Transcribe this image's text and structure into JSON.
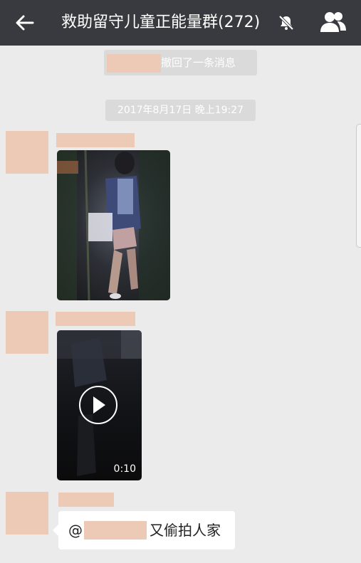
{
  "header": {
    "title": "救助留守儿童正能量群(272)",
    "back_icon": "arrow-left-icon",
    "mute_icon": "bell-off-icon",
    "members_icon": "group-members-icon",
    "background": "#393a3f"
  },
  "chat": {
    "recall_notice": "撤回了一条消息",
    "timestamp": "2017年8月17日 晚上19:27",
    "video_duration": "0:10",
    "video_icon": "play-icon",
    "message": {
      "mention_prefix": "@",
      "text": "又偷拍人家"
    }
  },
  "colors": {
    "redaction": "#eccab5",
    "chat_background": "#ebebeb",
    "bubble": "#ffffff"
  }
}
